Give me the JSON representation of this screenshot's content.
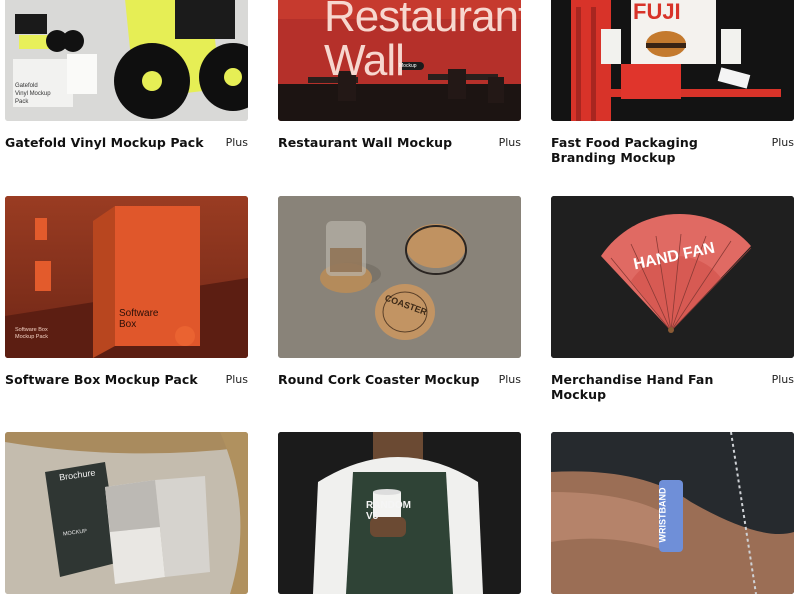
{
  "products": [
    {
      "title": "Gatefold Vinyl Mockup Pack",
      "tier": "Plus",
      "image_text": [
        "Gatefold",
        "Vinyl Mockup",
        "Pack"
      ]
    },
    {
      "title": "Restaurant Wall Mockup",
      "tier": "Plus",
      "image_text": [
        "Restaurant",
        "Wall",
        "Mockup"
      ]
    },
    {
      "title": "Fast Food Packaging Branding Mockup",
      "tier": "Plus",
      "image_text": [
        "FUJI"
      ]
    },
    {
      "title": "Software Box Mockup Pack",
      "tier": "Plus",
      "image_text": [
        "Software",
        "Box",
        "Software Box",
        "Mockup Pack"
      ]
    },
    {
      "title": "Round Cork Coaster Mockup",
      "tier": "Plus",
      "image_text": [
        "COASTER"
      ]
    },
    {
      "title": "Merchandise Hand Fan Mockup",
      "tier": "Plus",
      "image_text": [
        "HAND FAN"
      ]
    },
    {
      "title": "",
      "tier": "",
      "image_text": [
        "Brochure",
        "MOCKUP"
      ]
    },
    {
      "title": "",
      "tier": "",
      "image_text": [
        "RANDOM",
        "V5"
      ]
    },
    {
      "title": "",
      "tier": "",
      "image_text": [
        "WRISTBAND"
      ]
    }
  ]
}
